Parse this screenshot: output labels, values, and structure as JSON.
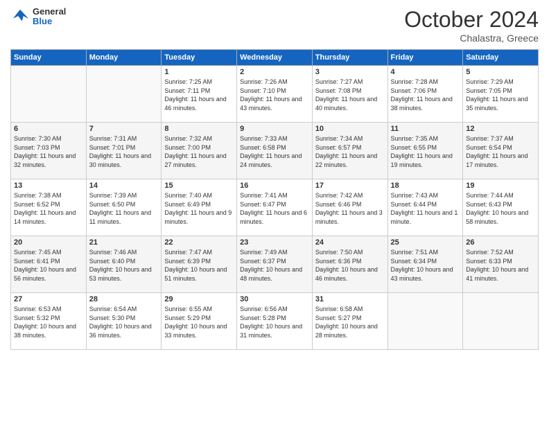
{
  "logo": {
    "line1": "General",
    "line2": "Blue"
  },
  "header": {
    "month": "October 2024",
    "location": "Chalastra, Greece"
  },
  "days_of_week": [
    "Sunday",
    "Monday",
    "Tuesday",
    "Wednesday",
    "Thursday",
    "Friday",
    "Saturday"
  ],
  "weeks": [
    [
      {
        "day": "",
        "sunrise": "",
        "sunset": "",
        "daylight": ""
      },
      {
        "day": "",
        "sunrise": "",
        "sunset": "",
        "daylight": ""
      },
      {
        "day": "1",
        "sunrise": "Sunrise: 7:25 AM",
        "sunset": "Sunset: 7:11 PM",
        "daylight": "Daylight: 11 hours and 46 minutes."
      },
      {
        "day": "2",
        "sunrise": "Sunrise: 7:26 AM",
        "sunset": "Sunset: 7:10 PM",
        "daylight": "Daylight: 11 hours and 43 minutes."
      },
      {
        "day": "3",
        "sunrise": "Sunrise: 7:27 AM",
        "sunset": "Sunset: 7:08 PM",
        "daylight": "Daylight: 11 hours and 40 minutes."
      },
      {
        "day": "4",
        "sunrise": "Sunrise: 7:28 AM",
        "sunset": "Sunset: 7:06 PM",
        "daylight": "Daylight: 11 hours and 38 minutes."
      },
      {
        "day": "5",
        "sunrise": "Sunrise: 7:29 AM",
        "sunset": "Sunset: 7:05 PM",
        "daylight": "Daylight: 11 hours and 35 minutes."
      }
    ],
    [
      {
        "day": "6",
        "sunrise": "Sunrise: 7:30 AM",
        "sunset": "Sunset: 7:03 PM",
        "daylight": "Daylight: 11 hours and 32 minutes."
      },
      {
        "day": "7",
        "sunrise": "Sunrise: 7:31 AM",
        "sunset": "Sunset: 7:01 PM",
        "daylight": "Daylight: 11 hours and 30 minutes."
      },
      {
        "day": "8",
        "sunrise": "Sunrise: 7:32 AM",
        "sunset": "Sunset: 7:00 PM",
        "daylight": "Daylight: 11 hours and 27 minutes."
      },
      {
        "day": "9",
        "sunrise": "Sunrise: 7:33 AM",
        "sunset": "Sunset: 6:58 PM",
        "daylight": "Daylight: 11 hours and 24 minutes."
      },
      {
        "day": "10",
        "sunrise": "Sunrise: 7:34 AM",
        "sunset": "Sunset: 6:57 PM",
        "daylight": "Daylight: 11 hours and 22 minutes."
      },
      {
        "day": "11",
        "sunrise": "Sunrise: 7:35 AM",
        "sunset": "Sunset: 6:55 PM",
        "daylight": "Daylight: 11 hours and 19 minutes."
      },
      {
        "day": "12",
        "sunrise": "Sunrise: 7:37 AM",
        "sunset": "Sunset: 6:54 PM",
        "daylight": "Daylight: 11 hours and 17 minutes."
      }
    ],
    [
      {
        "day": "13",
        "sunrise": "Sunrise: 7:38 AM",
        "sunset": "Sunset: 6:52 PM",
        "daylight": "Daylight: 11 hours and 14 minutes."
      },
      {
        "day": "14",
        "sunrise": "Sunrise: 7:39 AM",
        "sunset": "Sunset: 6:50 PM",
        "daylight": "Daylight: 11 hours and 11 minutes."
      },
      {
        "day": "15",
        "sunrise": "Sunrise: 7:40 AM",
        "sunset": "Sunset: 6:49 PM",
        "daylight": "Daylight: 11 hours and 9 minutes."
      },
      {
        "day": "16",
        "sunrise": "Sunrise: 7:41 AM",
        "sunset": "Sunset: 6:47 PM",
        "daylight": "Daylight: 11 hours and 6 minutes."
      },
      {
        "day": "17",
        "sunrise": "Sunrise: 7:42 AM",
        "sunset": "Sunset: 6:46 PM",
        "daylight": "Daylight: 11 hours and 3 minutes."
      },
      {
        "day": "18",
        "sunrise": "Sunrise: 7:43 AM",
        "sunset": "Sunset: 6:44 PM",
        "daylight": "Daylight: 11 hours and 1 minute."
      },
      {
        "day": "19",
        "sunrise": "Sunrise: 7:44 AM",
        "sunset": "Sunset: 6:43 PM",
        "daylight": "Daylight: 10 hours and 58 minutes."
      }
    ],
    [
      {
        "day": "20",
        "sunrise": "Sunrise: 7:45 AM",
        "sunset": "Sunset: 6:41 PM",
        "daylight": "Daylight: 10 hours and 56 minutes."
      },
      {
        "day": "21",
        "sunrise": "Sunrise: 7:46 AM",
        "sunset": "Sunset: 6:40 PM",
        "daylight": "Daylight: 10 hours and 53 minutes."
      },
      {
        "day": "22",
        "sunrise": "Sunrise: 7:47 AM",
        "sunset": "Sunset: 6:39 PM",
        "daylight": "Daylight: 10 hours and 51 minutes."
      },
      {
        "day": "23",
        "sunrise": "Sunrise: 7:49 AM",
        "sunset": "Sunset: 6:37 PM",
        "daylight": "Daylight: 10 hours and 48 minutes."
      },
      {
        "day": "24",
        "sunrise": "Sunrise: 7:50 AM",
        "sunset": "Sunset: 6:36 PM",
        "daylight": "Daylight: 10 hours and 46 minutes."
      },
      {
        "day": "25",
        "sunrise": "Sunrise: 7:51 AM",
        "sunset": "Sunset: 6:34 PM",
        "daylight": "Daylight: 10 hours and 43 minutes."
      },
      {
        "day": "26",
        "sunrise": "Sunrise: 7:52 AM",
        "sunset": "Sunset: 6:33 PM",
        "daylight": "Daylight: 10 hours and 41 minutes."
      }
    ],
    [
      {
        "day": "27",
        "sunrise": "Sunrise: 6:53 AM",
        "sunset": "Sunset: 5:32 PM",
        "daylight": "Daylight: 10 hours and 38 minutes."
      },
      {
        "day": "28",
        "sunrise": "Sunrise: 6:54 AM",
        "sunset": "Sunset: 5:30 PM",
        "daylight": "Daylight: 10 hours and 36 minutes."
      },
      {
        "day": "29",
        "sunrise": "Sunrise: 6:55 AM",
        "sunset": "Sunset: 5:29 PM",
        "daylight": "Daylight: 10 hours and 33 minutes."
      },
      {
        "day": "30",
        "sunrise": "Sunrise: 6:56 AM",
        "sunset": "Sunset: 5:28 PM",
        "daylight": "Daylight: 10 hours and 31 minutes."
      },
      {
        "day": "31",
        "sunrise": "Sunrise: 6:58 AM",
        "sunset": "Sunset: 5:27 PM",
        "daylight": "Daylight: 10 hours and 28 minutes."
      },
      {
        "day": "",
        "sunrise": "",
        "sunset": "",
        "daylight": ""
      },
      {
        "day": "",
        "sunrise": "",
        "sunset": "",
        "daylight": ""
      }
    ]
  ]
}
